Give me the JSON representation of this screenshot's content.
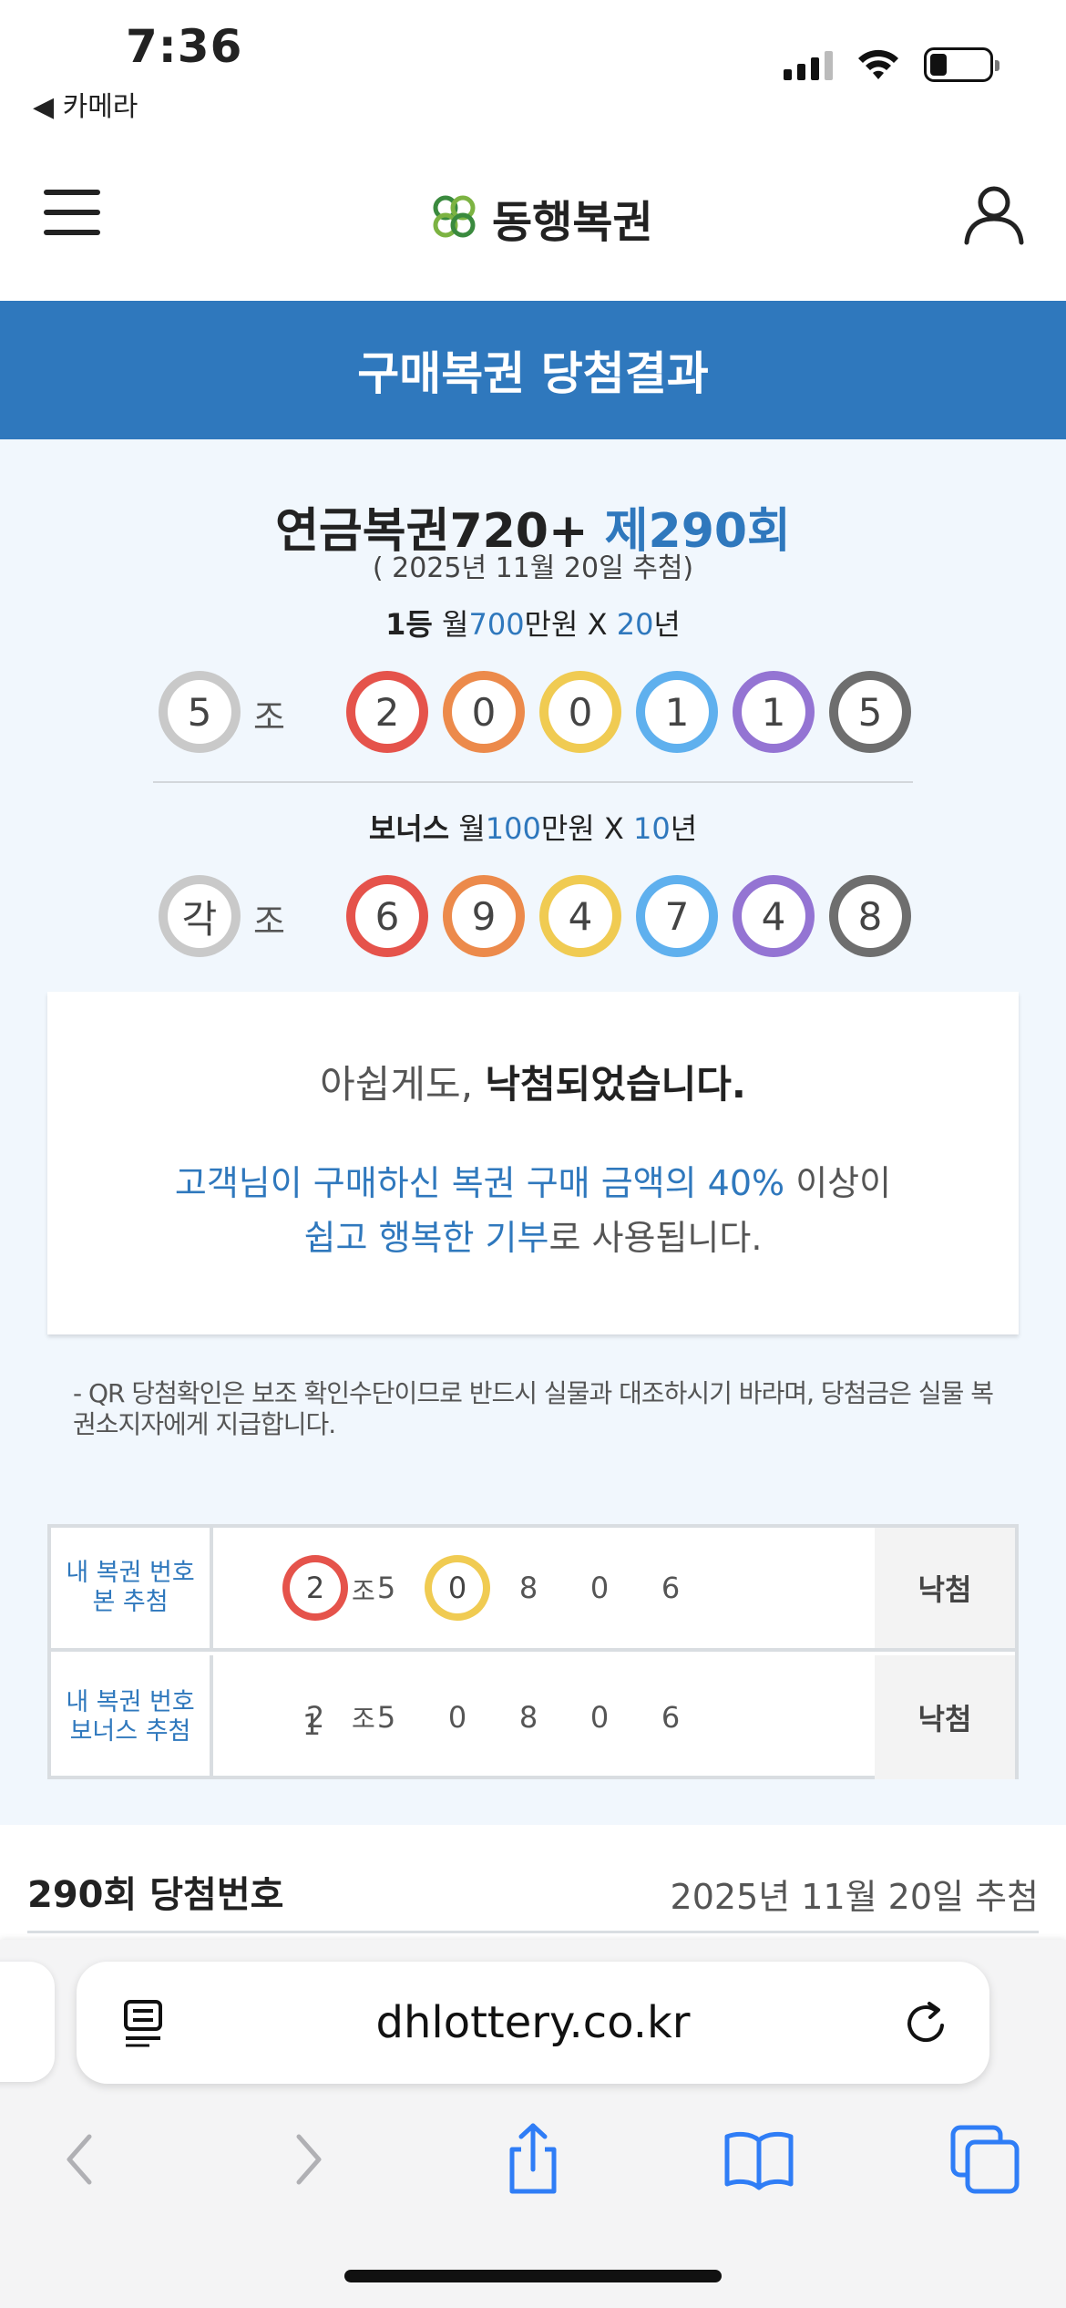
{
  "status_bar": {
    "time": "7:36",
    "back_label": "◀ 카메라"
  },
  "header": {
    "logo_text": "동행복권"
  },
  "banner": {
    "title": "구매복권 당첨결과"
  },
  "game": {
    "name": "연금복권720+",
    "round": "제290회",
    "draw_date": "( 2025년 11월 20일 추첨)"
  },
  "first_prize": {
    "rank": "1등",
    "monthly_prefix": "월",
    "monthly_amount": "700",
    "monthly_unit": "만원 X ",
    "years": "20",
    "years_unit": "년",
    "group": "5",
    "group_label": "조",
    "digits": [
      "2",
      "0",
      "0",
      "1",
      "1",
      "5"
    ]
  },
  "bonus_prize": {
    "rank": "보너스",
    "monthly_prefix": "월",
    "monthly_amount": "100",
    "monthly_unit": "만원 X ",
    "years": "10",
    "years_unit": "년",
    "group": "각",
    "group_label": "조",
    "digits": [
      "6",
      "9",
      "4",
      "7",
      "4",
      "8"
    ]
  },
  "ball_colors": [
    "#e5534b",
    "#ec8a4b",
    "#f0cb52",
    "#5fb0ee",
    "#9474d3",
    "#6e6e6e"
  ],
  "result": {
    "line1_prefix": "아쉽게도, ",
    "line1_bold": "낙첨되었습니다.",
    "line2_blue": "고객님이 구매하신 복권 구매 금액의 40%",
    "line2_rest": " 이상이",
    "line3_blue": "쉽고 행복한 기부",
    "line3_rest": "로 사용됩니다."
  },
  "notice": "- QR 당첨확인은 보조 확인수단이므로 반드시 실물과 대조하시기 바라며, 당첨금은 실물 복권소지자에게 지급합니다.",
  "my_tickets": [
    {
      "label_line1": "내 복권 번호",
      "label_line2": "본 추첨",
      "group": "1",
      "group_label": "조",
      "digits": [
        "2",
        "5",
        "0",
        "8",
        "0",
        "6"
      ],
      "matched": [
        true,
        false,
        true,
        false,
        false,
        false
      ],
      "result": "낙첨"
    },
    {
      "label_line1": "내 복권 번호",
      "label_line2": "보너스 추첨",
      "group": "1",
      "group_label": "조",
      "digits": [
        "2",
        "5",
        "0",
        "8",
        "0",
        "6"
      ],
      "matched": [
        false,
        false,
        false,
        false,
        false,
        false
      ],
      "result": "낙첨"
    }
  ],
  "next_section": {
    "title": "290회 당첨번호",
    "date": "2025년 11월 20일 추첨"
  },
  "browser": {
    "url": "dhlottery.co.kr"
  },
  "icons": [
    "hamburger-icon",
    "clover-logo-icon",
    "user-icon",
    "reader-icon",
    "reload-icon",
    "back-arrow-icon",
    "forward-arrow-icon",
    "share-icon",
    "bookmarks-icon",
    "tabs-icon"
  ]
}
